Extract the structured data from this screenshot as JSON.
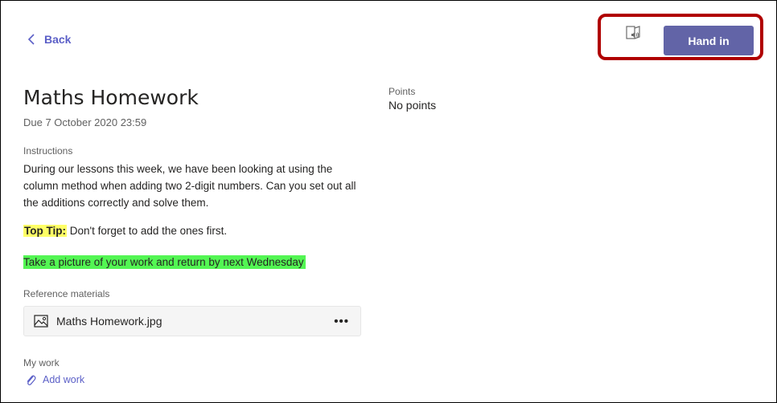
{
  "header": {
    "back_label": "Back",
    "hand_in_label": "Hand in"
  },
  "assignment": {
    "title": "Maths Homework",
    "due": "Due 7 October 2020 23:59",
    "instructions_label": "Instructions",
    "instructions_text": "During our lessons this week, we have been looking at using the column method when adding two 2-digit numbers. Can you set out all the additions correctly and solve them.",
    "tip_label": "Top Tip:",
    "tip_text": " Don't forget to add the ones first.",
    "return_note": "Take a picture of your work and return by next Wednesday"
  },
  "reference": {
    "label": "Reference materials",
    "files": [
      {
        "name": "Maths Homework.jpg",
        "icon": "image-file-icon"
      }
    ],
    "more_label": "•••"
  },
  "my_work": {
    "label": "My work",
    "add_label": "Add work"
  },
  "points": {
    "label": "Points",
    "value": "No points"
  },
  "colors": {
    "accent": "#6264a7",
    "link": "#5b5fc7",
    "tip_highlight": "#ffff66",
    "note_highlight": "#53f653",
    "annotation_border": "#b00000"
  }
}
